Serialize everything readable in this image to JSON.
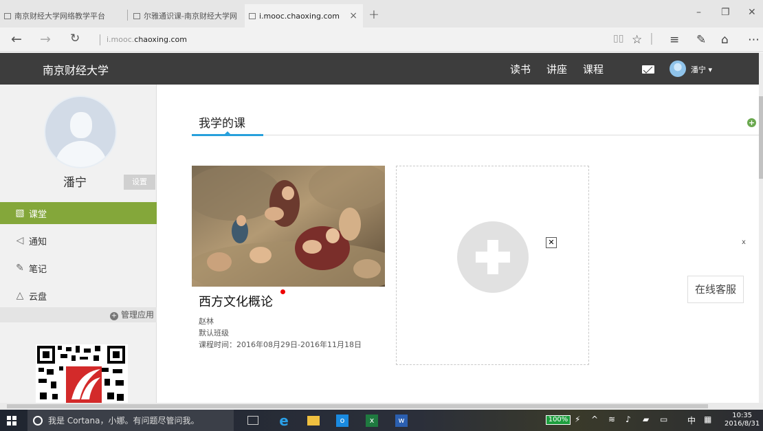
{
  "browser": {
    "tabs": [
      {
        "label": "南京财经大学网络教学平台"
      },
      {
        "label": "尔雅通识课-南京财经大学网"
      },
      {
        "label": "i.mooc.chaoxing.com",
        "active": true
      }
    ],
    "url_prefix": "i.mooc.",
    "url_domain": "chaoxing.com"
  },
  "site": {
    "name": "南京财经大学",
    "nav": [
      "读书",
      "讲座",
      "课程"
    ],
    "username": "潘宁 ▾"
  },
  "sidebar": {
    "profile_name": "潘宁",
    "settings_label": "设置",
    "items": [
      {
        "label": "课堂",
        "icon": "classroom-icon",
        "active": true
      },
      {
        "label": "通知",
        "icon": "notice-icon"
      },
      {
        "label": "笔记",
        "icon": "note-icon"
      },
      {
        "label": "云盘",
        "icon": "cloud-icon"
      }
    ],
    "manage_label": "管理应用"
  },
  "main": {
    "title": "我学的课",
    "course": {
      "name": "西方文化概论",
      "teacher": "赵林",
      "class": "默认班级",
      "period": "课程时间：2016年08月29日-2016年11月18日"
    },
    "service_label": "在线客服",
    "close_label": "x"
  },
  "taskbar": {
    "search_placeholder": "我是 Cortana，小娜。有问题尽管问我。",
    "battery": "100%",
    "ime": "中",
    "time": "10:35",
    "date": "2016/8/31"
  },
  "colors": {
    "accent_green": "#84a73a",
    "tab_blue": "#27a0dc",
    "header_dark": "#3d3d3d"
  }
}
